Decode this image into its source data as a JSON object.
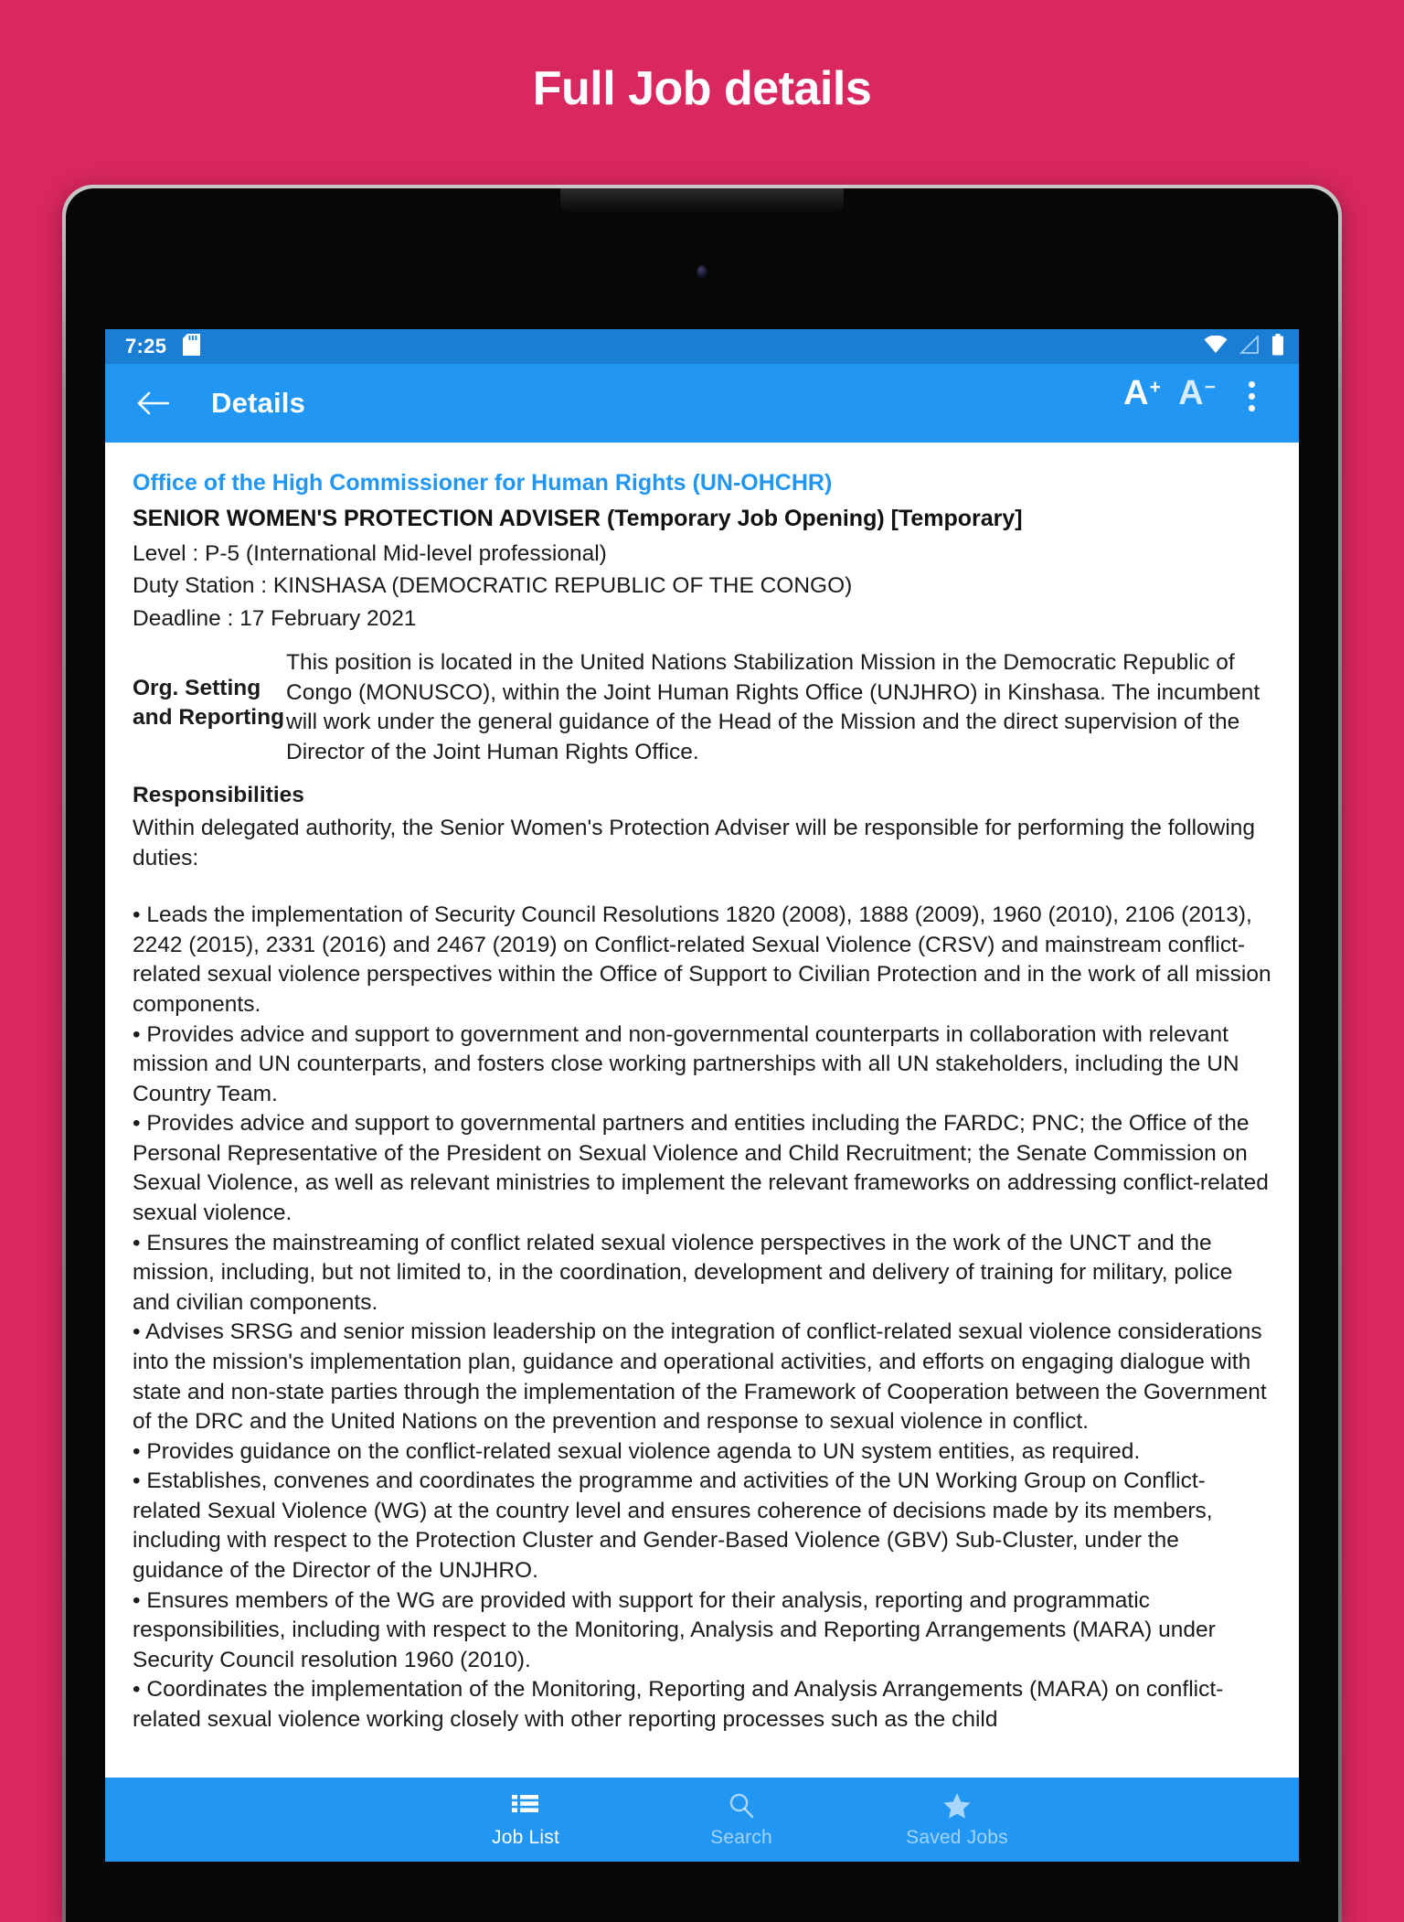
{
  "promo": {
    "title": "Full Job details"
  },
  "theme": {
    "background_pink": "#d9275f",
    "app_bar_blue": "#2196f3",
    "status_bar_blue": "#1a7fd4",
    "link_blue": "#2196f3"
  },
  "status_bar": {
    "time": "7:25",
    "icons": [
      "sd-card-icon",
      "wifi-icon",
      "signal-icon",
      "battery-icon"
    ]
  },
  "app_bar": {
    "back_icon": "back-arrow-icon",
    "title": "Details",
    "increase_font_label": "A",
    "increase_font_sup": "+",
    "decrease_font_label": "A",
    "decrease_font_sup": "−",
    "overflow_icon": "more-vertical-icon"
  },
  "job": {
    "organization": "Office of the High Commissioner for Human Rights (UN-OHCHR)",
    "title": "SENIOR WOMEN'S PROTECTION ADVISER (Temporary Job Opening) [Temporary]",
    "level": "Level : P-5 (International Mid-level professional)",
    "duty_station": "Duty Station : KINSHASA (DEMOCRATIC REPUBLIC OF THE CONGO)",
    "deadline": "Deadline : 17 February 2021",
    "org_setting_label": "Org. Setting and Reporting",
    "org_setting_text": "This position is located in the United Nations Stabilization Mission in the Democratic Republic of Congo (MONUSCO), within the Joint Human Rights Office (UNJHRO) in Kinshasa. The incumbent will work under the general guidance of the Head of the Mission and the direct supervision of the Director of the Joint Human Rights Office.",
    "responsibilities_heading": "Responsibilities",
    "responsibilities_intro": "Within delegated authority, the Senior Women's Protection Adviser will be responsible for performing the following duties:",
    "bullets": [
      "• Leads the implementation of Security Council Resolutions 1820 (2008), 1888 (2009), 1960 (2010), 2106 (2013), 2242 (2015), 2331 (2016) and 2467 (2019) on Conflict-related Sexual Violence (CRSV) and mainstream conflict-related sexual violence perspectives within the Office of Support to Civilian Protection and in the work of all mission components.",
      "• Provides advice and support to government and non-governmental counterparts in collaboration with relevant mission and UN counterparts, and fosters close working partnerships with all UN stakeholders, including the UN Country Team.",
      "• Provides advice and support to governmental partners and entities including the FARDC; PNC; the Office of the Personal Representative of the President on Sexual Violence and Child Recruitment; the Senate Commission on Sexual Violence, as well as relevant ministries to implement the relevant frameworks on addressing conflict-related sexual violence.",
      "• Ensures the mainstreaming of conflict related sexual violence perspectives in the work of the UNCT and the mission, including, but not limited to, in the coordination, development and delivery of training for military, police and civilian components.",
      "• Advises SRSG and senior mission leadership on the integration of conflict-related sexual violence considerations into the mission's implementation plan, guidance and operational activities, and efforts on engaging dialogue with state and non-state parties through the implementation of the Framework of Cooperation between the Government of the DRC and the United Nations on the prevention and response to sexual violence in conflict.",
      "• Provides guidance on the conflict-related sexual violence agenda to UN system entities, as required.",
      "• Establishes, convenes and coordinates the programme and activities of the UN Working Group on Conflict-related Sexual Violence (WG) at the country level and ensures coherence of decisions made by its members, including with respect to the Protection Cluster and Gender-Based Violence (GBV) Sub-Cluster, under the guidance of the Director of the UNJHRO.",
      "• Ensures members of the WG are provided with support for their analysis, reporting and programmatic responsibilities, including with respect to the Monitoring, Analysis and Reporting Arrangements (MARA) under Security Council resolution 1960 (2010).",
      "• Coordinates the implementation of the Monitoring, Reporting and Analysis Arrangements (MARA) on conflict-related sexual violence working closely with other reporting processes such as the child"
    ]
  },
  "bottom_nav": {
    "items": [
      {
        "label": "Job List",
        "icon": "list-icon",
        "active": true
      },
      {
        "label": "Search",
        "icon": "search-icon",
        "active": false
      },
      {
        "label": "Saved Jobs",
        "icon": "star-icon",
        "active": false
      }
    ]
  }
}
